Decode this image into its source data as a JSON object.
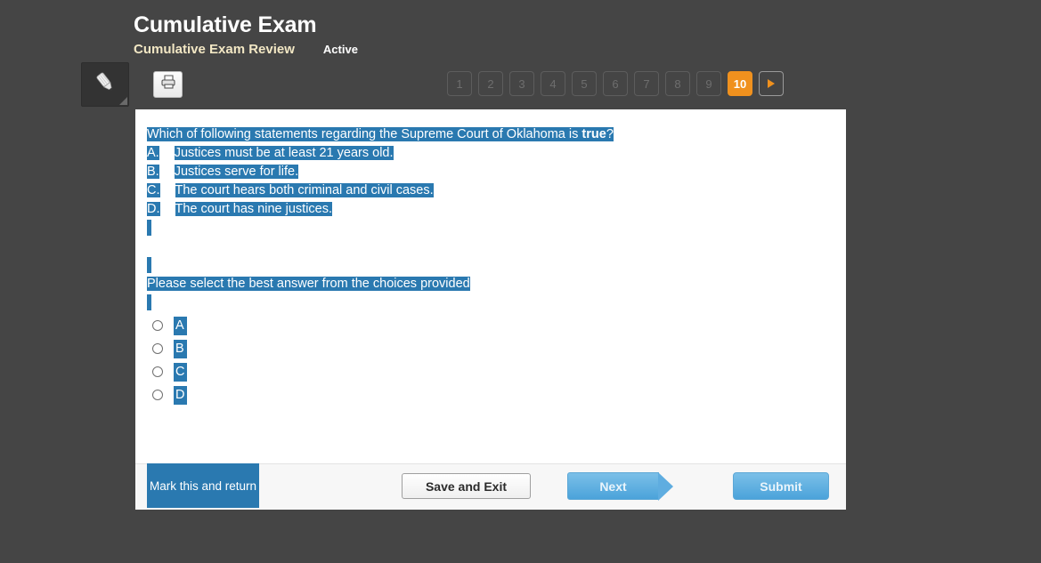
{
  "header": {
    "title": "Cumulative Exam",
    "subtitle": "Cumulative Exam Review",
    "status": "Active",
    "subtitle_color": "#f2e7c4",
    "background_color": "#454545"
  },
  "toolbar": {
    "highlighter_icon": "highlighter-pen-icon",
    "print_icon": "printer-icon"
  },
  "pagination": {
    "pages": [
      "1",
      "2",
      "3",
      "4",
      "5",
      "6",
      "7",
      "8",
      "9",
      "10"
    ],
    "current": "10",
    "active_color": "#f0911e",
    "next_icon": "next-arrow-icon"
  },
  "question": {
    "stem_before": "Which of following statements regarding the Supreme Court of Oklahoma is ",
    "stem_bold": "true",
    "stem_after": "?",
    "choices": [
      {
        "letter": "A.",
        "text": "Justices must be at least 21 years old."
      },
      {
        "letter": "B.",
        "text": "Justices serve for life."
      },
      {
        "letter": "C.",
        "text": "The court hears both criminal and civil cases."
      },
      {
        "letter": "D.",
        "text": "The court has nine justices."
      }
    ],
    "prompt": "Please select the best answer from the choices provided",
    "selection_color": "#2a79b0"
  },
  "answers": {
    "options": [
      "A",
      "B",
      "C",
      "D"
    ],
    "selected": null
  },
  "footer": {
    "mark_label": "Mark this and return",
    "save_label": "Save and Exit",
    "next_label": "Next",
    "submit_label": "Submit"
  }
}
